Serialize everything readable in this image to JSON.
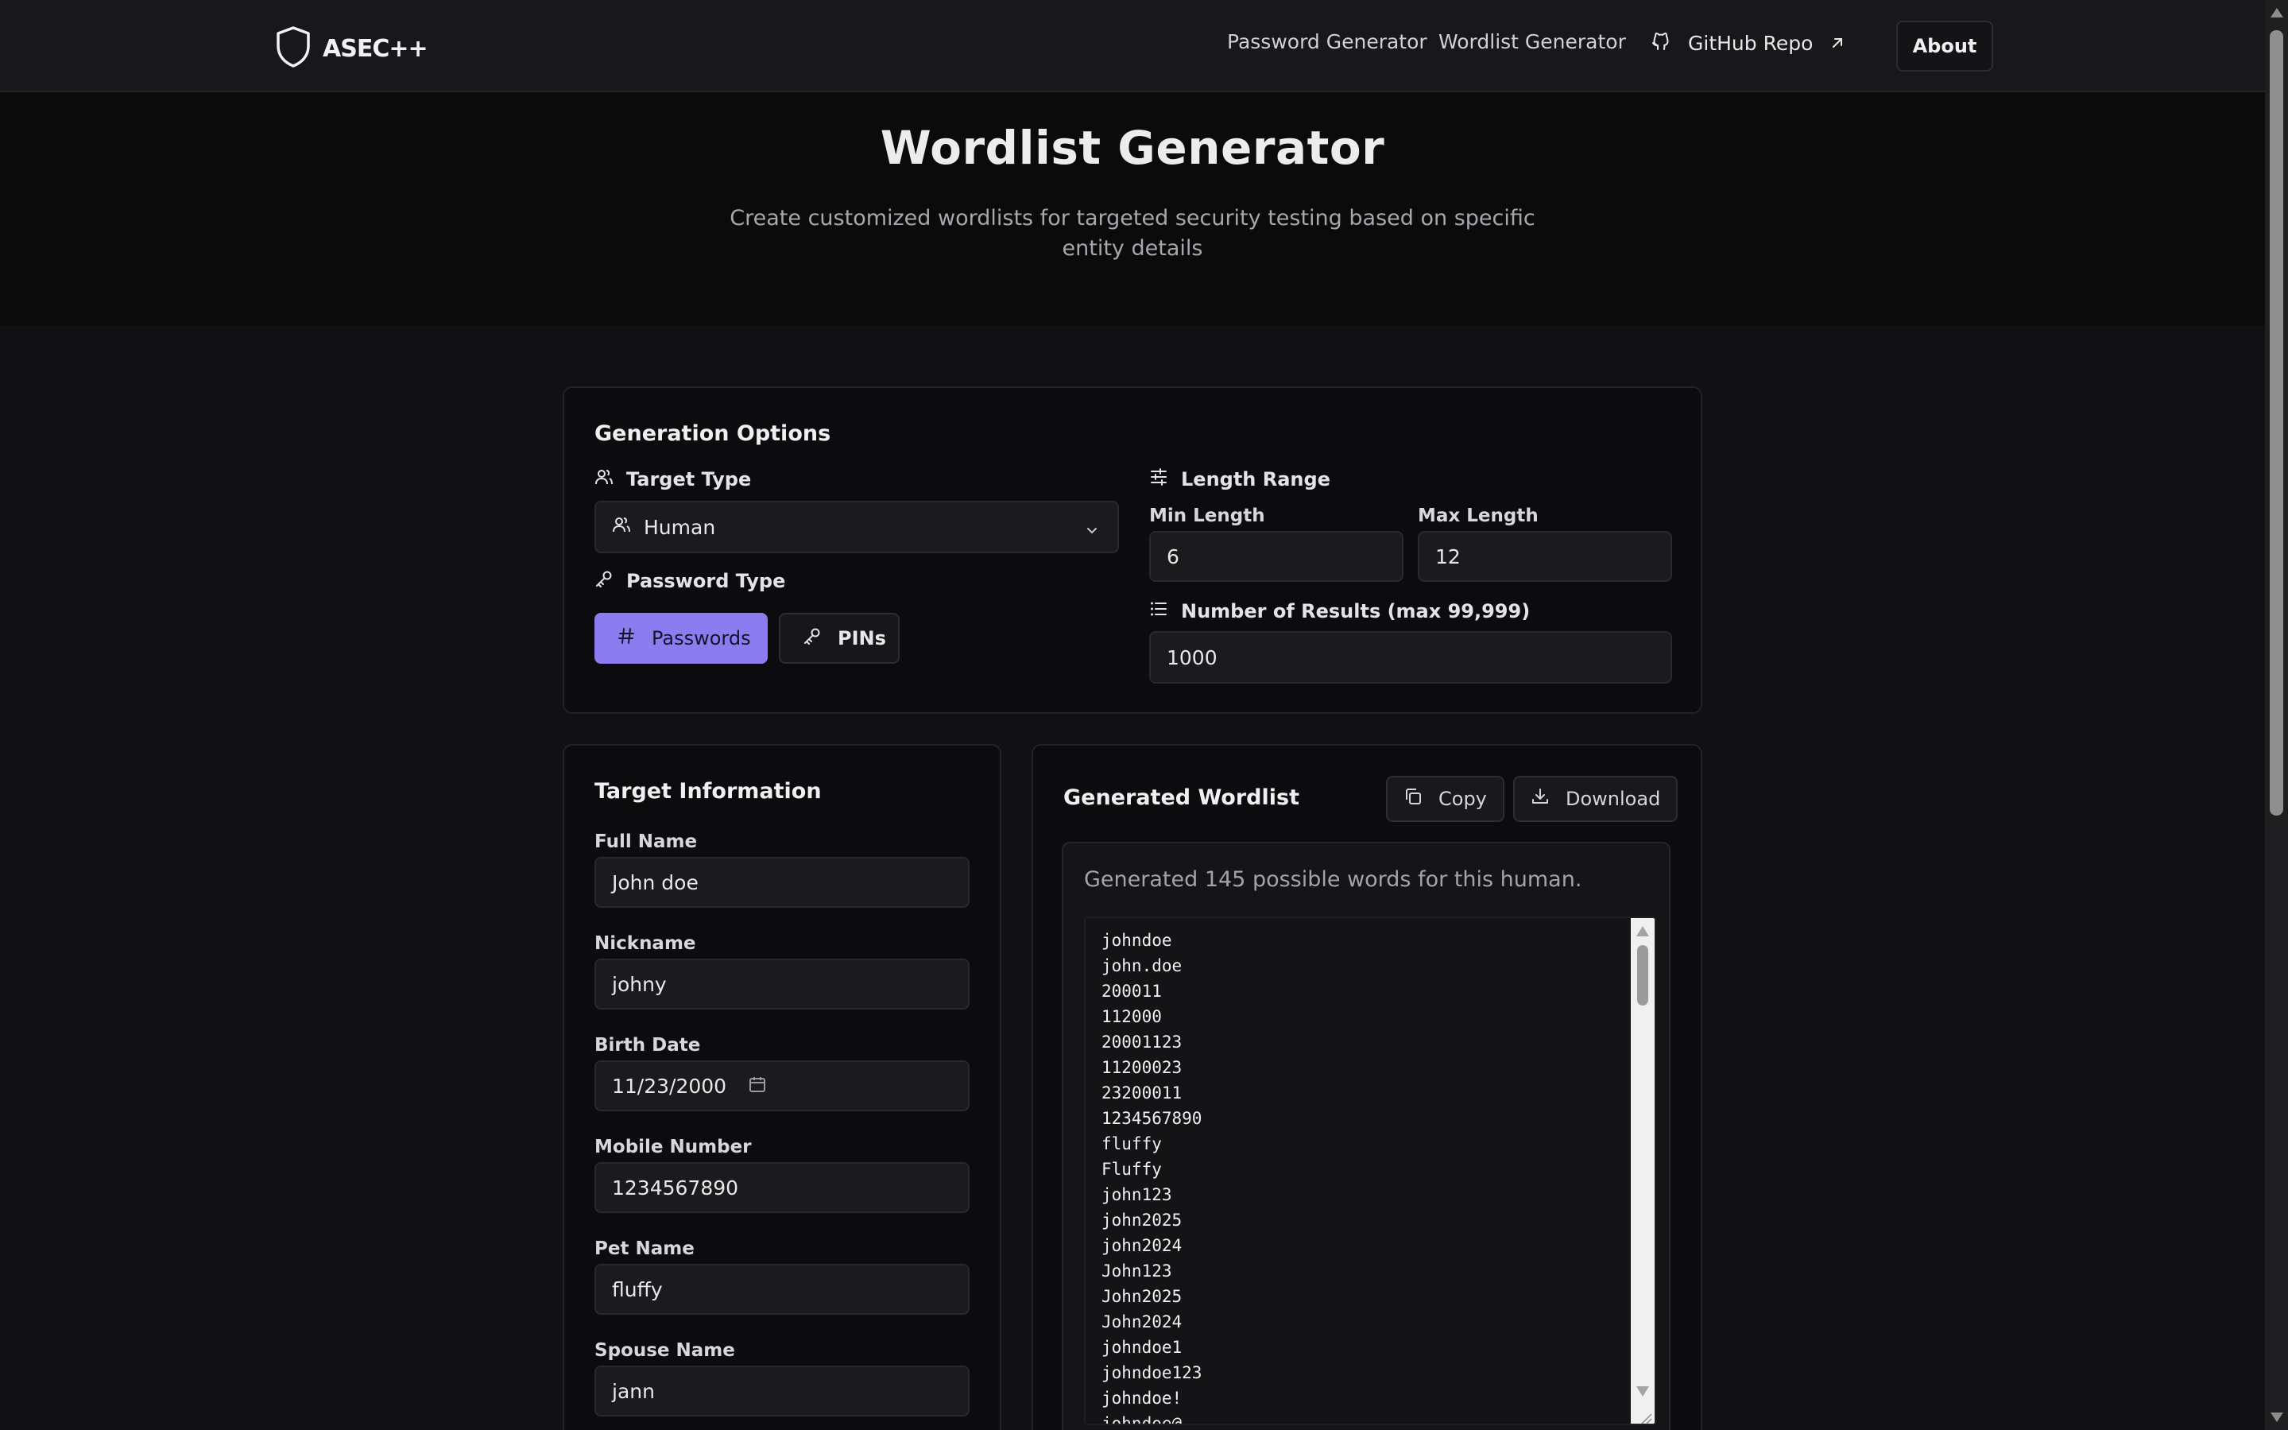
{
  "brand": {
    "name": "ASEC++"
  },
  "nav": {
    "links": [
      "Password Generator",
      "Wordlist Generator"
    ],
    "github": "GitHub Repo",
    "about": "About"
  },
  "hero": {
    "title": "Wordlist Generator",
    "subtitle": "Create customized wordlists for targeted security testing based on specific entity details"
  },
  "options": {
    "title": "Generation Options",
    "target_type_label": "Target Type",
    "target_type_value": "Human",
    "password_type_label": "Password Type",
    "password_btn": "Passwords",
    "pins_btn": "PINs",
    "length_range_label": "Length Range",
    "min_label": "Min Length",
    "min_value": "6",
    "max_label": "Max Length",
    "max_value": "12",
    "results_label": "Number of Results (max 99,999)",
    "results_value": "1000"
  },
  "target": {
    "title": "Target Information",
    "fields": [
      {
        "label": "Full Name",
        "value": "John doe"
      },
      {
        "label": "Nickname",
        "value": "johny"
      },
      {
        "label": "Birth Date",
        "value": "11/23/2000"
      },
      {
        "label": "Mobile Number",
        "value": "1234567890"
      },
      {
        "label": "Pet Name",
        "value": "fluffy"
      },
      {
        "label": "Spouse Name",
        "value": "jann"
      }
    ]
  },
  "output": {
    "title": "Generated Wordlist",
    "copy": "Copy",
    "download": "Download",
    "summary": "Generated 145 possible words for this human.",
    "words": [
      "johndoe",
      "john.doe",
      "200011",
      "112000",
      "20001123",
      "11200023",
      "23200011",
      "1234567890",
      "fluffy",
      "Fluffy",
      "john123",
      "john2025",
      "john2024",
      "John123",
      "John2025",
      "John2024",
      "johndoe1",
      "johndoe123",
      "johndoe!",
      "johndoe@"
    ]
  }
}
